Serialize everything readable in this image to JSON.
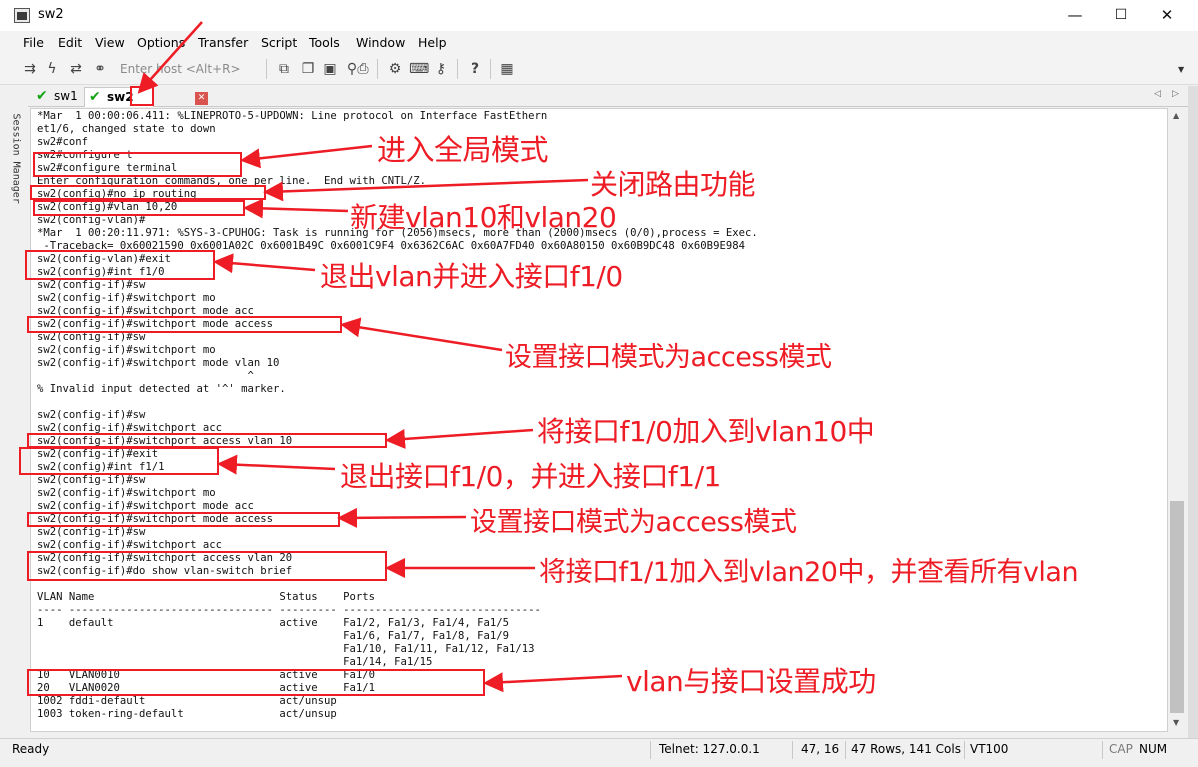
{
  "window": {
    "title": "sw2",
    "controls": {
      "minimize": "—",
      "maximize": "☐",
      "close": "✕"
    }
  },
  "menu": [
    "File",
    "Edit",
    "View",
    "Options",
    "Transfer",
    "Script",
    "Tools",
    "Window",
    "Help"
  ],
  "toolbar": {
    "host_placeholder": "Enter host <Alt+R>",
    "icons": [
      "connect-icon",
      "lightning-icon",
      "reconnect-icon",
      "disconnect-icon",
      "copy-icon",
      "paste-icon",
      "clipboard-icon",
      "find-icon",
      "print-icon",
      "settings-icon",
      "keymap-icon",
      "keys-icon",
      "help-icon",
      "script-icon"
    ]
  },
  "sidebar": {
    "label": "Session Manager"
  },
  "tabs": [
    {
      "label": "sw1",
      "active": false
    },
    {
      "label": "sw2",
      "active": true
    }
  ],
  "terminal": {
    "lines": [
      "*Mar  1 00:00:06.411: %LINEPROTO-5-UPDOWN: Line protocol on Interface FastEthern",
      "et1/6, changed state to down",
      "sw2#conf",
      "sw2#configure t",
      "sw2#configure terminal",
      "Enter configuration commands, one per line.  End with CNTL/Z.",
      "sw2(config)#no ip routing",
      "sw2(config)#vlan 10,20",
      "sw2(config-vlan)#",
      "*Mar  1 00:20:11.971: %SYS-3-CPUHOG: Task is running for (2056)msecs, more than (2000)msecs (0/0),process = Exec.",
      " -Traceback= 0x60021590 0x6001A02C 0x6001B49C 0x6001C9F4 0x6362C6AC 0x60A7FD40 0x60A80150 0x60B9DC48 0x60B9E984",
      "sw2(config-vlan)#exit",
      "sw2(config)#int f1/0",
      "sw2(config-if)#sw",
      "sw2(config-if)#switchport mo",
      "sw2(config-if)#switchport mode acc",
      "sw2(config-if)#switchport mode access",
      "sw2(config-if)#sw",
      "sw2(config-if)#switchport mo",
      "sw2(config-if)#switchport mode vlan 10",
      "                                 ^",
      "% Invalid input detected at '^' marker.",
      "",
      "sw2(config-if)#sw",
      "sw2(config-if)#switchport acc",
      "sw2(config-if)#switchport access vlan 10",
      "sw2(config-if)#exit",
      "sw2(config)#int f1/1",
      "sw2(config-if)#sw",
      "sw2(config-if)#switchport mo",
      "sw2(config-if)#switchport mode acc",
      "sw2(config-if)#switchport mode access",
      "sw2(config-if)#sw",
      "sw2(config-if)#switchport acc",
      "sw2(config-if)#switchport access vlan 20",
      "sw2(config-if)#do show vlan-switch brief",
      "",
      "VLAN Name                             Status    Ports",
      "---- -------------------------------- --------- -------------------------------",
      "1    default                          active    Fa1/2, Fa1/3, Fa1/4, Fa1/5",
      "                                                Fa1/6, Fa1/7, Fa1/8, Fa1/9",
      "                                                Fa1/10, Fa1/11, Fa1/12, Fa1/13",
      "                                                Fa1/14, Fa1/15",
      "10   VLAN0010                         active    Fa1/0",
      "20   VLAN0020                         active    Fa1/1",
      "1002 fddi-default                     act/unsup",
      "1003 token-ring-default               act/unsup"
    ]
  },
  "annotations": [
    "进入全局模式",
    "关闭路由功能",
    "新建vlan10和vlan20",
    "退出vlan并进入接口f1/0",
    "设置接口模式为access模式",
    "将接口f1/0加入到vlan10中",
    "退出接口f1/0，并进入接口f1/1",
    "设置接口模式为access模式",
    "将接口f1/1加入到vlan20中，并查看所有vlan",
    "vlan与接口设置成功"
  ],
  "status": {
    "ready": "Ready",
    "connection": "Telnet: 127.0.0.1",
    "cursor": "47,  16",
    "size": "47 Rows, 141 Cols",
    "emulation": "VT100",
    "cap": "CAP",
    "num": "NUM"
  },
  "colors": {
    "annotation": "#ee1c25",
    "tab_check": "#13a313"
  }
}
